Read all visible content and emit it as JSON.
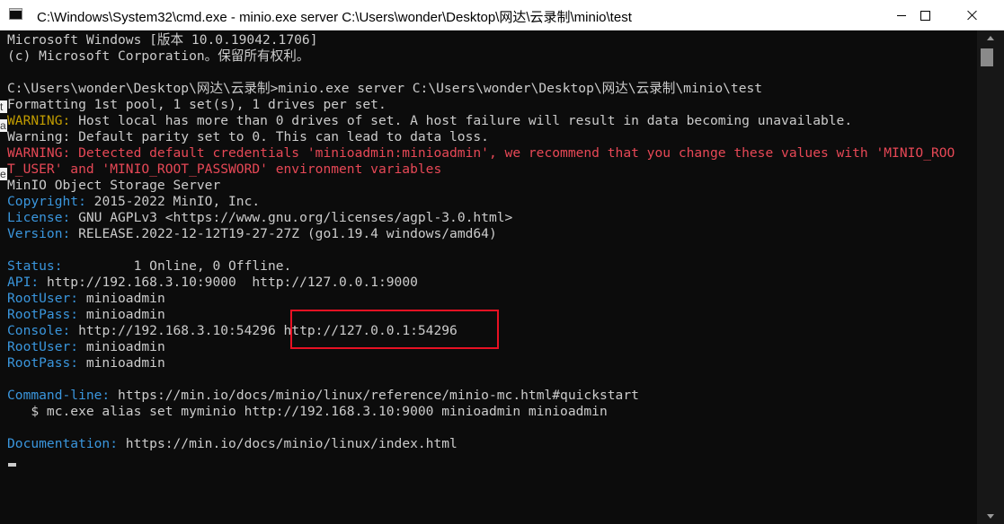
{
  "window": {
    "title": "C:\\Windows\\System32\\cmd.exe - minio.exe  server C:\\Users\\wonder\\Desktop\\网达\\云录制\\minio\\test",
    "minimize_glyph": "minimize-icon",
    "maximize_glyph": "maximize-icon",
    "close_glyph": "close-icon"
  },
  "colors": {
    "console_bg": "#0c0c0c",
    "text": "#cccccc",
    "label_blue": "#3a96dd",
    "warning_yellow": "#c19c00",
    "warning_red": "#e74856",
    "highlight_box": "#e81123"
  },
  "console": {
    "header1": "Microsoft Windows [版本 10.0.19042.1706]",
    "header2": "(c) Microsoft Corporation。保留所有权利。",
    "prompt": "C:\\Users\\wonder\\Desktop\\网达\\云录制>minio.exe server C:\\Users\\wonder\\Desktop\\网达\\云录制\\minio\\test",
    "formatting": "Formatting 1st pool, 1 set(s), 1 drives per set.",
    "warn1_label": "WARNING:",
    "warn1_text": " Host local has more than 0 drives of set. A host failure will result in data becoming unavailable.",
    "warn2": "Warning: Default parity set to 0. This can lead to data loss.",
    "warn3_line1": "WARNING: Detected default credentials 'minioadmin:minioadmin', we recommend that you change these values with 'MINIO_ROO",
    "warn3_line2": "T_USER' and 'MINIO_ROOT_PASSWORD' environment variables",
    "server_name": "MinIO Object Storage Server",
    "copyright_label": "Copyright:",
    "copyright_value": " 2015-2022 MinIO, Inc.",
    "license_label": "License:",
    "license_value": " GNU AGPLv3 <https://www.gnu.org/licenses/agpl-3.0.html>",
    "version_label": "Version:",
    "version_value": " RELEASE.2022-12-12T19-27-27Z (go1.19.4 windows/amd64)",
    "status_label": "Status:",
    "status_value": "         1 Online, 0 Offline.",
    "api_label": "API:",
    "api_value": " http://192.168.3.10:9000  http://127.0.0.1:9000",
    "rootuser_label": "RootUser:",
    "rootuser_value": " minioadmin",
    "rootpass_label": "RootPass:",
    "rootpass_value": " minioadmin",
    "console_label": "Console:",
    "console_value": " http://192.168.3.10:54296 http://127.0.0.1:54296",
    "rootuser2_label": "RootUser:",
    "rootuser2_value": " minioadmin",
    "rootpass2_label": "RootPass:",
    "rootpass2_value": " minioadmin",
    "cmdline_label": "Command-line:",
    "cmdline_value": " https://min.io/docs/minio/linux/reference/minio-mc.html#quickstart",
    "mc_alias": "   $ mc.exe alias set myminio http://192.168.3.10:9000 minioadmin minioadmin",
    "docs_label": "Documentation:",
    "docs_value": " https://min.io/docs/minio/linux/index.html"
  },
  "background_glimpse": [
    "t",
    "a",
    "e"
  ]
}
